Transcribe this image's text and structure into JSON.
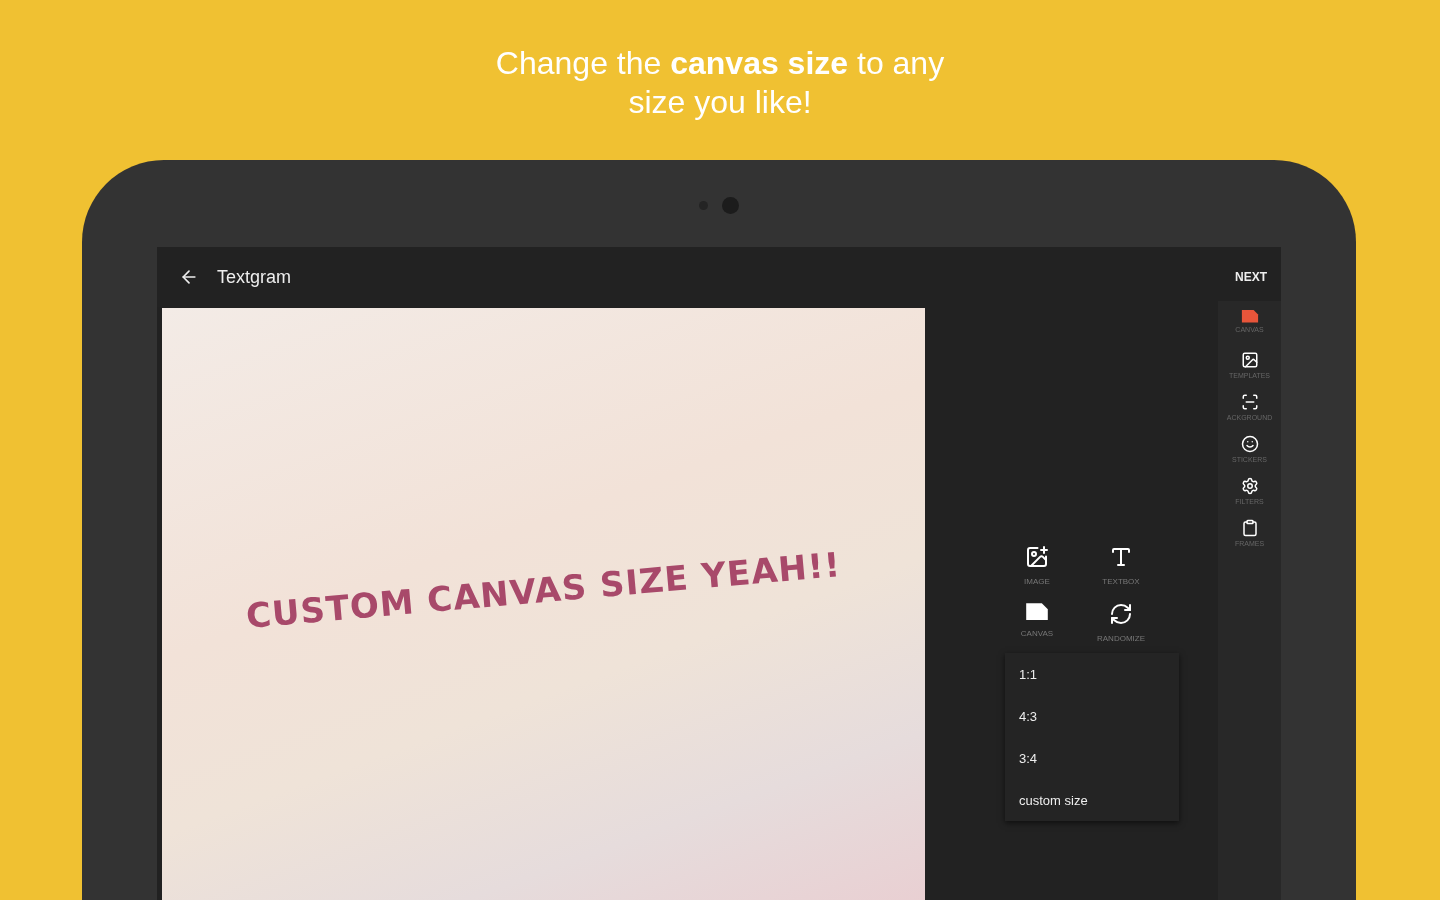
{
  "headline": "Change the **canvas size** to any size you like!",
  "app_bar": {
    "title": "Textgram",
    "action": "NEXT"
  },
  "canvas": {
    "text": "CUSTOM CANVAS SIZE YEAH!!"
  },
  "tools": [
    {
      "label": "IMAGE",
      "kind": "image"
    },
    {
      "label": "TEXTBOX",
      "kind": "textbox"
    },
    {
      "label": "CANVAS",
      "kind": "canvas"
    },
    {
      "label": "RANDOMIZE",
      "kind": "randomize"
    }
  ],
  "ratio_menu": [
    "1:1",
    "4:3",
    "3:4",
    "custom size"
  ],
  "sidebar": [
    {
      "label": "CANVAS",
      "kind": "canvas",
      "selected": true
    },
    {
      "label": "TEMPLATES",
      "kind": "templates",
      "selected": false
    },
    {
      "label": "ACKGROUND",
      "kind": "background",
      "selected": false
    },
    {
      "label": "STICKERS",
      "kind": "stickers",
      "selected": false
    },
    {
      "label": "FILTERS",
      "kind": "filters",
      "selected": false
    },
    {
      "label": "FRAMES",
      "kind": "frames",
      "selected": false
    }
  ]
}
